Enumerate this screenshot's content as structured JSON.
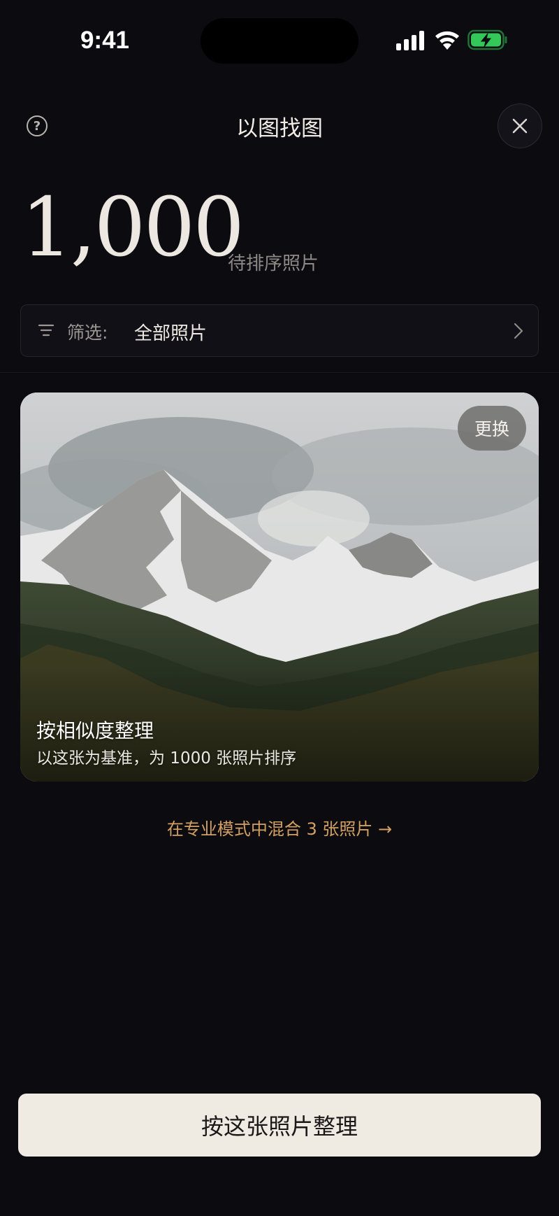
{
  "status_bar": {
    "time": "9:41",
    "signal_icon": "cellular-signal-icon",
    "wifi_icon": "wifi-icon",
    "battery_icon": "battery-charging-icon",
    "battery_color": "#34c759"
  },
  "header": {
    "help_icon": "question-circle-icon",
    "help_glyph": "?",
    "title": "以图找图",
    "close_icon": "close-icon"
  },
  "summary": {
    "count": "1,000",
    "count_label": "待排序照片"
  },
  "filter": {
    "icon": "filter-lines-icon",
    "label": "筛选:",
    "value": "全部照片",
    "chevron_icon": "chevron-right-icon"
  },
  "photo_card": {
    "change_label": "更换",
    "title": "按相似度整理",
    "subtitle": "以这张为基准，为 1000 张照片排序"
  },
  "pro_link": {
    "label": "在专业模式中混合 3 张照片 →",
    "color": "#d2a062"
  },
  "primary_action": {
    "label": "按这张照片整理"
  }
}
